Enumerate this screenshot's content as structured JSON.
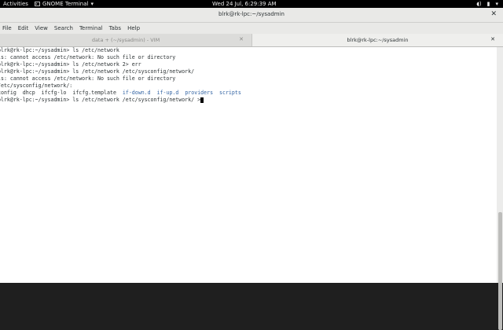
{
  "topbar": {
    "activities": "Activities",
    "app_name": "GNOME Terminal",
    "clock": "Wed 24 Jul, 6:29:39 AM"
  },
  "window": {
    "title": "blrk@rk-lpc:~/sysadmin"
  },
  "menu": [
    "File",
    "Edit",
    "View",
    "Search",
    "Terminal",
    "Tabs",
    "Help"
  ],
  "tabs": [
    {
      "label": "data + (~/sysadmin) - VIM"
    },
    {
      "label": "blrk@rk-lpc:~/sysadmin"
    }
  ],
  "terminal": {
    "lines": [
      "blrk@rk-lpc:~/sysadmin> ls /etc/network",
      "ls: cannot access /etc/network: No such file or directory",
      "blrk@rk-lpc:~/sysadmin> ls /etc/network 2> err",
      "blrk@rk-lpc:~/sysadmin> ls /etc/network /etc/sysconfig/network/",
      "ls: cannot access /etc/network: No such file or directory",
      "/etc/sysconfig/network/:"
    ],
    "listing": {
      "files": [
        "config",
        "dhcp",
        "ifcfg-lo",
        "ifcfg.template"
      ],
      "dirs": [
        "if-down.d",
        "if-up.d",
        "providers",
        "scripts"
      ]
    },
    "prompt_line": "blrk@rk-lpc:~/sysadmin> ls /etc/network /etc/sysconfig/network/ >"
  },
  "colors": {
    "dir": "#3465a4",
    "background": "#ffffff"
  }
}
